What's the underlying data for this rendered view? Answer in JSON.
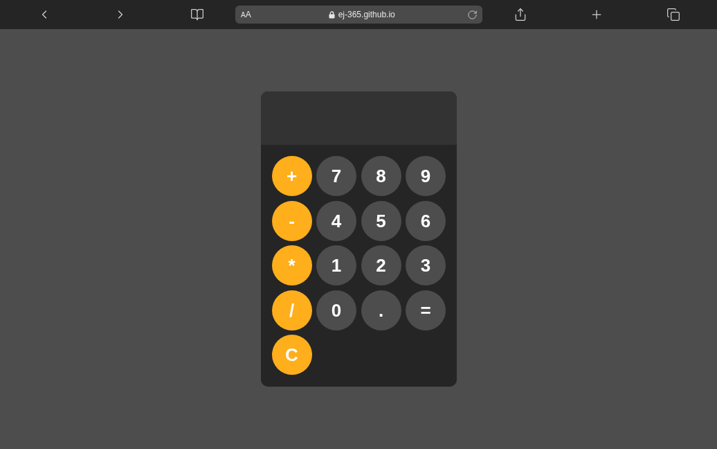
{
  "browser_toolbar": {
    "text_size_button": {
      "label_small": "A",
      "label_large": "A"
    },
    "address": "ej-365.github.io"
  },
  "calculator": {
    "keys": [
      {
        "label": "+",
        "kind": "operator"
      },
      {
        "label": "7",
        "kind": "digit"
      },
      {
        "label": "8",
        "kind": "digit"
      },
      {
        "label": "9",
        "kind": "digit"
      },
      {
        "label": "-",
        "kind": "operator"
      },
      {
        "label": "4",
        "kind": "digit"
      },
      {
        "label": "5",
        "kind": "digit"
      },
      {
        "label": "6",
        "kind": "digit"
      },
      {
        "label": "*",
        "kind": "operator"
      },
      {
        "label": "1",
        "kind": "digit"
      },
      {
        "label": "2",
        "kind": "digit"
      },
      {
        "label": "3",
        "kind": "digit"
      },
      {
        "label": "/",
        "kind": "operator"
      },
      {
        "label": "0",
        "kind": "digit"
      },
      {
        "label": ".",
        "kind": "decimal"
      },
      {
        "label": "=",
        "kind": "equals"
      },
      {
        "label": "C",
        "kind": "clear"
      }
    ]
  }
}
